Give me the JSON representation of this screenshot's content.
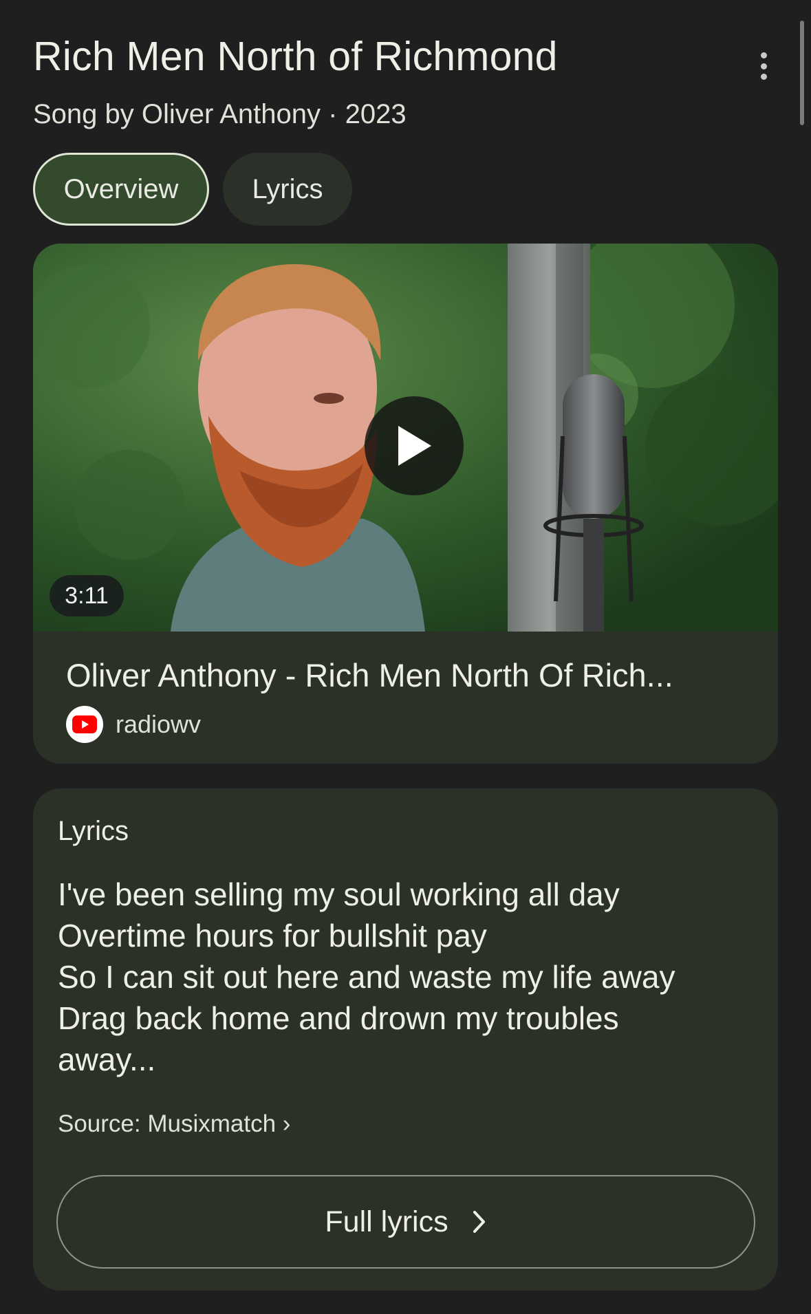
{
  "header": {
    "title": "Rich Men North of Richmond",
    "subtitle": "Song by Oliver Anthony · 2023",
    "more_icon": "more-vert-icon"
  },
  "tabs": [
    {
      "label": "Overview",
      "active": true
    },
    {
      "label": "Lyrics",
      "active": false
    }
  ],
  "video": {
    "duration": "3:11",
    "title": "Oliver Anthony - Rich Men North Of Rich...",
    "channel": "radiowv",
    "channel_icon": "youtube-icon",
    "play_icon": "play-icon"
  },
  "lyrics": {
    "heading": "Lyrics",
    "lines": [
      "I've been selling my soul working all day",
      "Overtime hours for bullshit pay",
      "So I can sit out here and waste my life away",
      "Drag back home and drown my troubles",
      "away..."
    ],
    "source": "Source: Musixmatch ›",
    "full_lyrics_label": "Full lyrics",
    "full_lyrics_icon": "chevron-right-icon"
  },
  "colors": {
    "background": "#1f1f1f",
    "card": "#2c3128",
    "active_tab": "#344a2c",
    "youtube_red": "#ff0000"
  }
}
